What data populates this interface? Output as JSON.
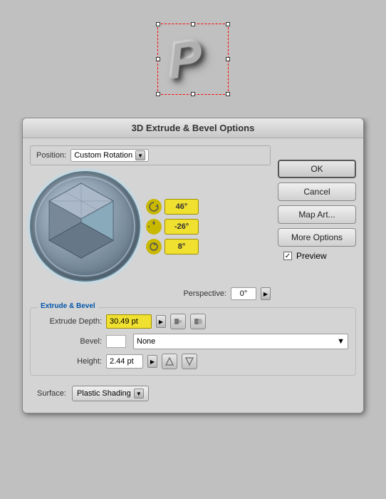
{
  "canvas": {
    "p_letter": "P"
  },
  "dialog": {
    "title": "3D Extrude & Bevel Options",
    "position": {
      "label": "Position:",
      "value": "Custom Rotation"
    },
    "angles": {
      "x": "46°",
      "y": "-26°",
      "z": "8°"
    },
    "perspective": {
      "label": "Perspective:",
      "value": "0°"
    },
    "buttons": {
      "ok": "OK",
      "cancel": "Cancel",
      "map_art": "Map Art...",
      "more_options": "More Options",
      "preview": "Preview"
    },
    "extrude_bevel": {
      "section_title": "Extrude & Bevel",
      "extrude_depth_label": "Extrude Depth:",
      "extrude_depth_value": "30.49 pt",
      "bevel_label": "Bevel:",
      "bevel_value": "None",
      "height_label": "Height:",
      "height_value": "2.44 pt"
    },
    "surface": {
      "label": "Surface:",
      "value": "Plastic Shading"
    }
  }
}
